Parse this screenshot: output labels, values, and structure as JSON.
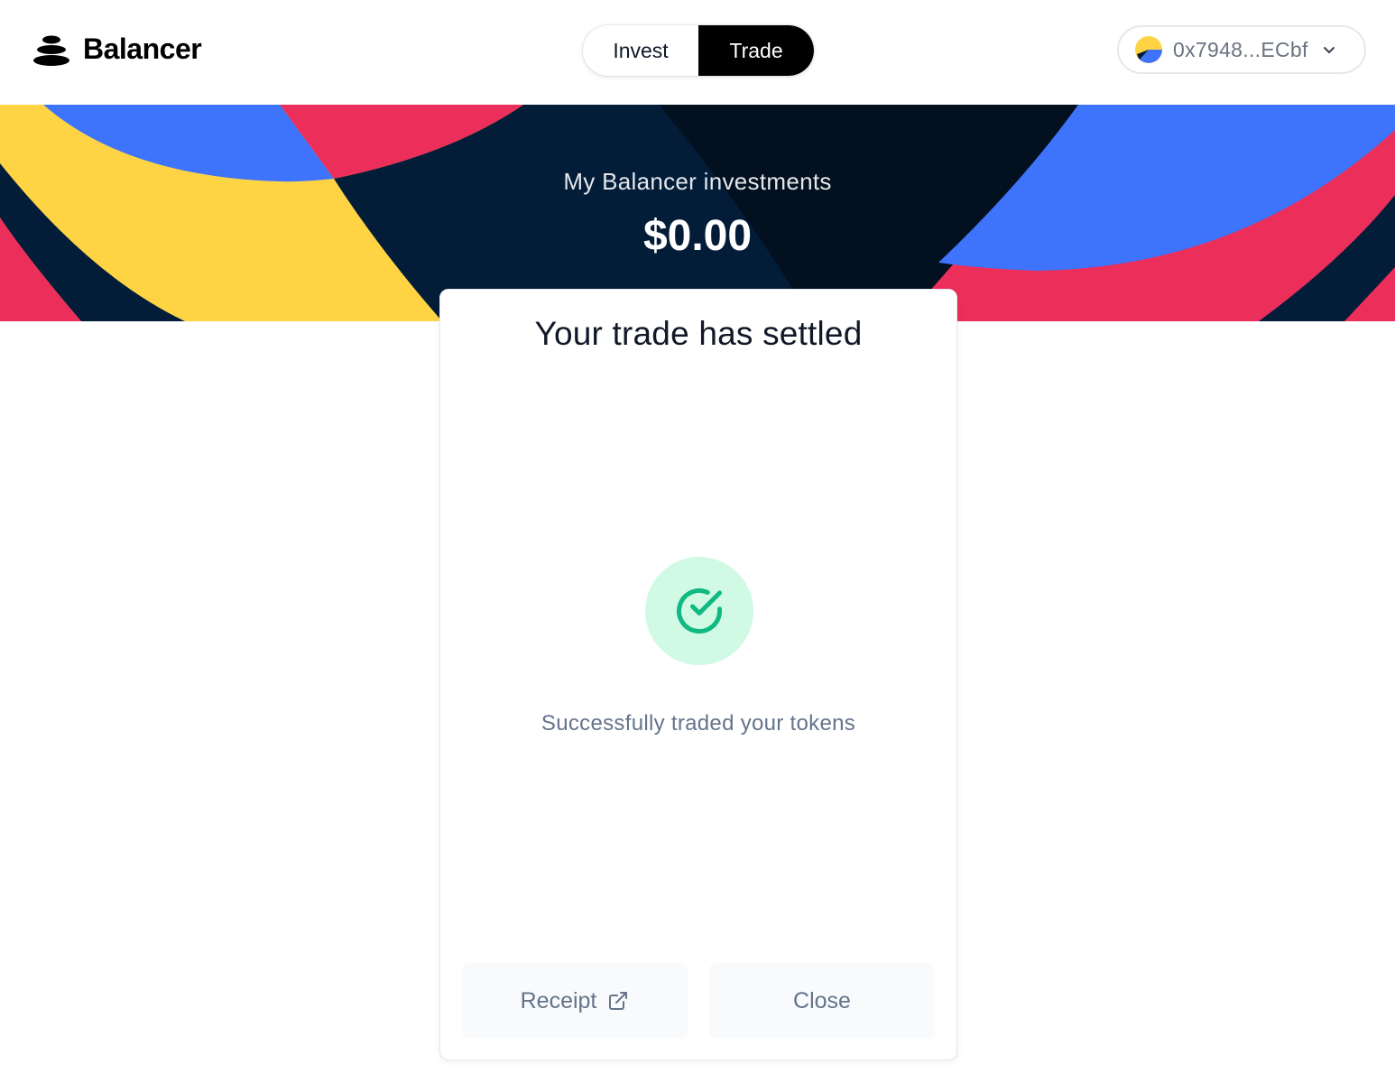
{
  "header": {
    "brand": "Balancer",
    "nav": [
      {
        "label": "Invest",
        "active": false
      },
      {
        "label": "Trade",
        "active": true
      }
    ],
    "account": {
      "address": "0x7948...ECbf",
      "avatar_icon": "wallet-avatar-icon",
      "chevron_icon": "chevron-down-icon"
    }
  },
  "hero": {
    "label": "My Balancer investments",
    "value": "$0.00"
  },
  "modal": {
    "title": "Your trade has settled",
    "status_icon": "check-circle-icon",
    "message": "Successfully traded your tokens",
    "buttons": {
      "receipt": "Receipt",
      "receipt_icon": "external-link-icon",
      "close": "Close"
    }
  },
  "colors": {
    "navy": "#031d39",
    "blue": "#3e74fb",
    "yellow": "#fed445",
    "red": "#ec2e5a",
    "success_bg": "#d1fae5",
    "success_fg": "#10b981"
  }
}
